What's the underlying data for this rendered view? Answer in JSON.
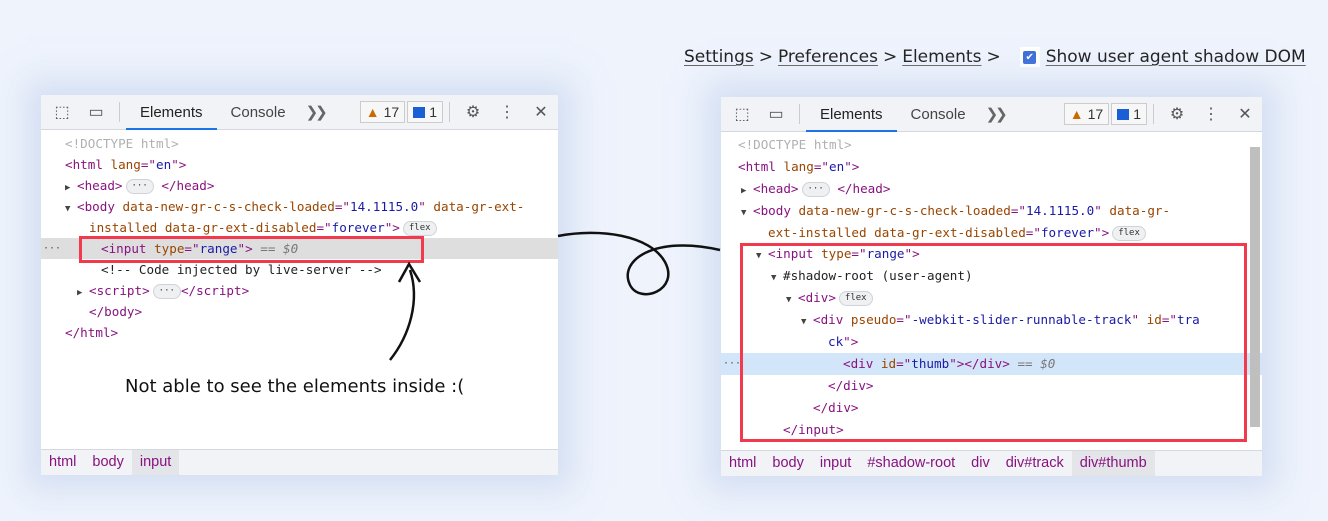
{
  "settings_path": {
    "items": [
      "Settings",
      "Preferences",
      "Elements"
    ],
    "separator": ">",
    "checkbox_label": "Show user agent shadow DOM",
    "checkbox_checked": true
  },
  "left_panel": {
    "tabs": [
      "Elements",
      "Console"
    ],
    "warnings": "17",
    "messages": "1",
    "lines": [
      {
        "indent": 0,
        "tri": "",
        "sel": false,
        "tokens": [
          {
            "t": "<!DOCTYPE html>",
            "k": "doctype"
          }
        ]
      },
      {
        "indent": 0,
        "tri": "",
        "sel": false,
        "tokens": [
          {
            "t": "<html ",
            "k": "tag"
          },
          {
            "t": "lang",
            "k": "attr"
          },
          {
            "t": "=\"",
            "k": "tag"
          },
          {
            "t": "en",
            "k": "val"
          },
          {
            "t": "\">",
            "k": "tag"
          }
        ]
      },
      {
        "indent": 1,
        "tri": "▶",
        "sel": false,
        "tokens": [
          {
            "t": "<head>",
            "k": "tag"
          },
          {
            "t": "···",
            "k": "pill"
          },
          {
            "t": " </head>",
            "k": "tag"
          }
        ]
      },
      {
        "indent": 1,
        "tri": "▼",
        "sel": false,
        "tokens": [
          {
            "t": "<body ",
            "k": "tag"
          },
          {
            "t": "data-new-gr-c-s-check-loaded",
            "k": "attr"
          },
          {
            "t": "=\"",
            "k": "tag"
          },
          {
            "t": "14.1115.0",
            "k": "val"
          },
          {
            "t": "\" ",
            "k": "tag"
          },
          {
            "t": "data-gr-ext-",
            "k": "attr"
          }
        ]
      },
      {
        "indent": 2,
        "tri": "",
        "sel": false,
        "tokens": [
          {
            "t": "installed data-gr-ext-disabled",
            "k": "attr"
          },
          {
            "t": "=\"",
            "k": "tag"
          },
          {
            "t": "forever",
            "k": "val"
          },
          {
            "t": "\">",
            "k": "tag"
          },
          {
            "t": "flex",
            "k": "pill"
          }
        ]
      },
      {
        "indent": 3,
        "tri": "",
        "sel": true,
        "tokens": [
          {
            "t": "<input ",
            "k": "tag"
          },
          {
            "t": "type",
            "k": "attr"
          },
          {
            "t": "=\"",
            "k": "tag"
          },
          {
            "t": "range",
            "k": "val"
          },
          {
            "t": "\">",
            "k": "tag"
          },
          {
            "t": " == $0",
            "k": "dim"
          }
        ]
      },
      {
        "indent": 3,
        "tri": "",
        "sel": false,
        "tokens": [
          {
            "t": "<!-- Code injected by live-server -->",
            "k": "text"
          }
        ]
      },
      {
        "indent": 2,
        "tri": "▶",
        "sel": false,
        "tokens": [
          {
            "t": "<script>",
            "k": "tag"
          },
          {
            "t": "···",
            "k": "pill"
          },
          {
            "t": "</script>",
            "k": "tag"
          }
        ]
      },
      {
        "indent": 2,
        "tri": "",
        "sel": false,
        "tokens": [
          {
            "t": "</body>",
            "k": "tag"
          }
        ]
      },
      {
        "indent": 0,
        "tri": "",
        "sel": false,
        "tokens": [
          {
            "t": "</html>",
            "k": "tag"
          }
        ]
      }
    ],
    "breadcrumbs": [
      "html",
      "body",
      "input"
    ],
    "note": "Not able to see the elements inside :("
  },
  "right_panel": {
    "tabs": [
      "Elements",
      "Console"
    ],
    "warnings": "17",
    "messages": "1",
    "lines": [
      {
        "indent": 0,
        "tri": "",
        "sel": false,
        "tokens": [
          {
            "t": "<!DOCTYPE html>",
            "k": "doctype"
          }
        ]
      },
      {
        "indent": 0,
        "tri": "",
        "sel": false,
        "tokens": [
          {
            "t": "<html ",
            "k": "tag"
          },
          {
            "t": "lang",
            "k": "attr"
          },
          {
            "t": "=\"",
            "k": "tag"
          },
          {
            "t": "en",
            "k": "val"
          },
          {
            "t": "\">",
            "k": "tag"
          }
        ]
      },
      {
        "indent": 1,
        "tri": "▶",
        "sel": false,
        "tokens": [
          {
            "t": "<head>",
            "k": "tag"
          },
          {
            "t": "···",
            "k": "pill"
          },
          {
            "t": " </head>",
            "k": "tag"
          }
        ]
      },
      {
        "indent": 1,
        "tri": "▼",
        "sel": false,
        "tokens": [
          {
            "t": "<body ",
            "k": "tag"
          },
          {
            "t": "data-new-gr-c-s-check-loaded",
            "k": "attr"
          },
          {
            "t": "=\"",
            "k": "tag"
          },
          {
            "t": "14.1115.0",
            "k": "val"
          },
          {
            "t": "\" ",
            "k": "tag"
          },
          {
            "t": "data-gr-",
            "k": "attr"
          }
        ]
      },
      {
        "indent": 2,
        "tri": "",
        "sel": false,
        "tokens": [
          {
            "t": "ext-installed data-gr-ext-disabled",
            "k": "attr"
          },
          {
            "t": "=\"",
            "k": "tag"
          },
          {
            "t": "forever",
            "k": "val"
          },
          {
            "t": "\">",
            "k": "tag"
          },
          {
            "t": "flex",
            "k": "pill"
          }
        ]
      },
      {
        "indent": 2,
        "tri": "▼",
        "sel": false,
        "tokens": [
          {
            "t": "<input ",
            "k": "tag"
          },
          {
            "t": "type",
            "k": "attr"
          },
          {
            "t": "=\"",
            "k": "tag"
          },
          {
            "t": "range",
            "k": "val"
          },
          {
            "t": "\">",
            "k": "tag"
          }
        ]
      },
      {
        "indent": 3,
        "tri": "▼",
        "sel": false,
        "tokens": [
          {
            "t": "#shadow-root (user-agent)",
            "k": "text"
          }
        ]
      },
      {
        "indent": 4,
        "tri": "▼",
        "sel": false,
        "tokens": [
          {
            "t": "<div>",
            "k": "tag"
          },
          {
            "t": "flex",
            "k": "pill"
          }
        ]
      },
      {
        "indent": 5,
        "tri": "▼",
        "sel": false,
        "tokens": [
          {
            "t": "<div ",
            "k": "tag"
          },
          {
            "t": "pseudo",
            "k": "attr"
          },
          {
            "t": "=\"",
            "k": "tag"
          },
          {
            "t": "-webkit-slider-runnable-track",
            "k": "val"
          },
          {
            "t": "\" ",
            "k": "tag"
          },
          {
            "t": "id",
            "k": "attr"
          },
          {
            "t": "=\"",
            "k": "tag"
          },
          {
            "t": "tra",
            "k": "val"
          }
        ]
      },
      {
        "indent": 6,
        "tri": "",
        "sel": false,
        "tokens": [
          {
            "t": "ck",
            "k": "val"
          },
          {
            "t": "\">",
            "k": "tag"
          }
        ]
      },
      {
        "indent": 7,
        "tri": "",
        "sel": true,
        "tokens": [
          {
            "t": "<div ",
            "k": "tag"
          },
          {
            "t": "id",
            "k": "attr"
          },
          {
            "t": "=\"",
            "k": "tag"
          },
          {
            "t": "thumb",
            "k": "val"
          },
          {
            "t": "\"></div>",
            "k": "tag"
          },
          {
            "t": " == $0",
            "k": "dim"
          }
        ]
      },
      {
        "indent": 6,
        "tri": "",
        "sel": false,
        "tokens": [
          {
            "t": "</div>",
            "k": "tag"
          }
        ]
      },
      {
        "indent": 5,
        "tri": "",
        "sel": false,
        "tokens": [
          {
            "t": "</div>",
            "k": "tag"
          }
        ]
      },
      {
        "indent": 3,
        "tri": "",
        "sel": false,
        "tokens": [
          {
            "t": "</input>",
            "k": "tag"
          }
        ]
      }
    ],
    "breadcrumbs": [
      "html",
      "body",
      "input",
      "#shadow-root",
      "div",
      "div#track",
      "div#thumb"
    ]
  },
  "colors": {
    "highlight_box": "#f23a4f",
    "tag": "#881280",
    "attr": "#994500",
    "value": "#1a1aa6",
    "selected_left": "#dedede",
    "selected_right": "#d3e5f8"
  }
}
